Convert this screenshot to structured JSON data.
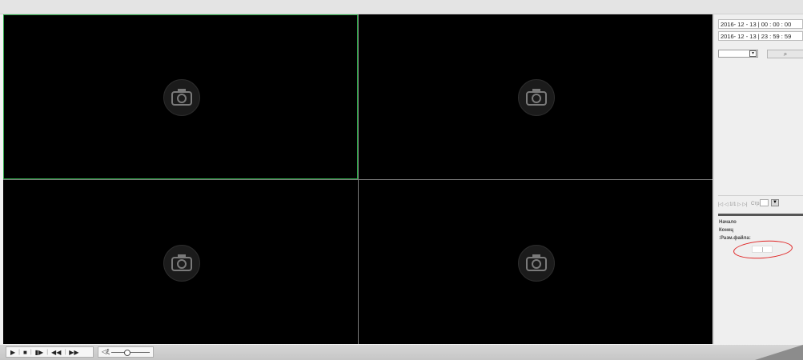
{
  "search_panel": {
    "start_datetime": "2016- 12 - 13 | 00 : 00 : 00",
    "end_datetime": "2016- 12 - 13 | 23 : 59 : 59",
    "type_select_value": "",
    "search_icon": "search-icon"
  },
  "pagination": {
    "controls": "|◁ ◁ 1/1 ▷ ▷|",
    "page_label": "Стр.",
    "page_input": "",
    "go_icon": "arrow-down-icon"
  },
  "file_info": {
    "start_label": "Начало",
    "end_label": "Конец",
    "size_label": ":Разм.файла:"
  },
  "player_toolbar": {
    "play": "▶",
    "stop": "■",
    "step": "▮▶",
    "rewind": "◀◀",
    "fast_forward": "▶▶",
    "volume_icon": "speaker-icon",
    "volume_level": 0.4
  },
  "colors": {
    "active_cell_border": "#2fa84a",
    "annotation_circle": "#e02424"
  }
}
